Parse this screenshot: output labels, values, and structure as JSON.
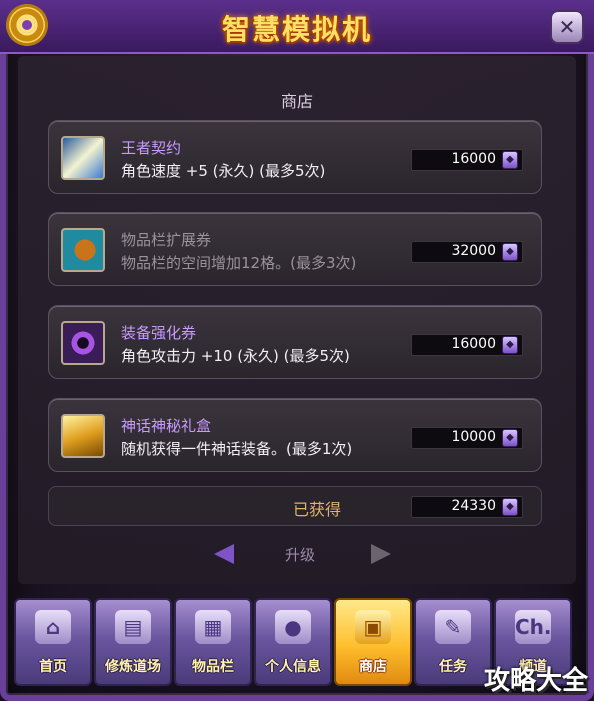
{
  "window": {
    "title": "智慧模拟机",
    "close_label": "✕"
  },
  "shop": {
    "section_label": "商店",
    "items": [
      {
        "name": "王者契约",
        "desc": "角色速度 +5 (永久) (最多5次)",
        "price": "16000",
        "name_color": "#c89bff",
        "icon": "contract-scroll-icon"
      },
      {
        "name": "物品栏扩展券",
        "desc": "物品栏的空间增加12格。(最多3次)",
        "price": "32000",
        "name_color": "#9a9399",
        "icon": "inventory-bag-icon"
      },
      {
        "name": "装备强化券",
        "desc": "角色攻击力 +10 (永久) (最多5次)",
        "price": "16000",
        "name_color": "#c89bff",
        "icon": "enhance-orb-icon"
      },
      {
        "name": "神话神秘礼盒",
        "desc": "随机获得一件神话装备。(最多1次)",
        "price": "10000",
        "name_color": "#c89bff",
        "icon": "gold-gift-box-icon"
      }
    ],
    "gained_label": "已获得",
    "gained_value": "24330",
    "currency_icon": "purple-token-icon"
  },
  "pager": {
    "label": "升级"
  },
  "tabs": [
    {
      "label": "首页",
      "icon_glyph": "⌂",
      "icon": "home-icon",
      "active": false
    },
    {
      "label": "修炼道场",
      "icon_glyph": "▤",
      "icon": "training-scroll-icon",
      "active": false
    },
    {
      "label": "物品栏",
      "icon_glyph": "▦",
      "icon": "inventory-icon",
      "active": false
    },
    {
      "label": "个人信息",
      "icon_glyph": "●",
      "icon": "profile-icon",
      "active": false
    },
    {
      "label": "商店",
      "icon_glyph": "▣",
      "icon": "shop-chest-icon",
      "active": true
    },
    {
      "label": "任务",
      "icon_glyph": "✎",
      "icon": "quest-scroll-icon",
      "active": false
    },
    {
      "label": "频道",
      "icon_glyph": "Ch.",
      "icon": "channel-icon",
      "active": false
    }
  ],
  "watermark": "攻略大全"
}
